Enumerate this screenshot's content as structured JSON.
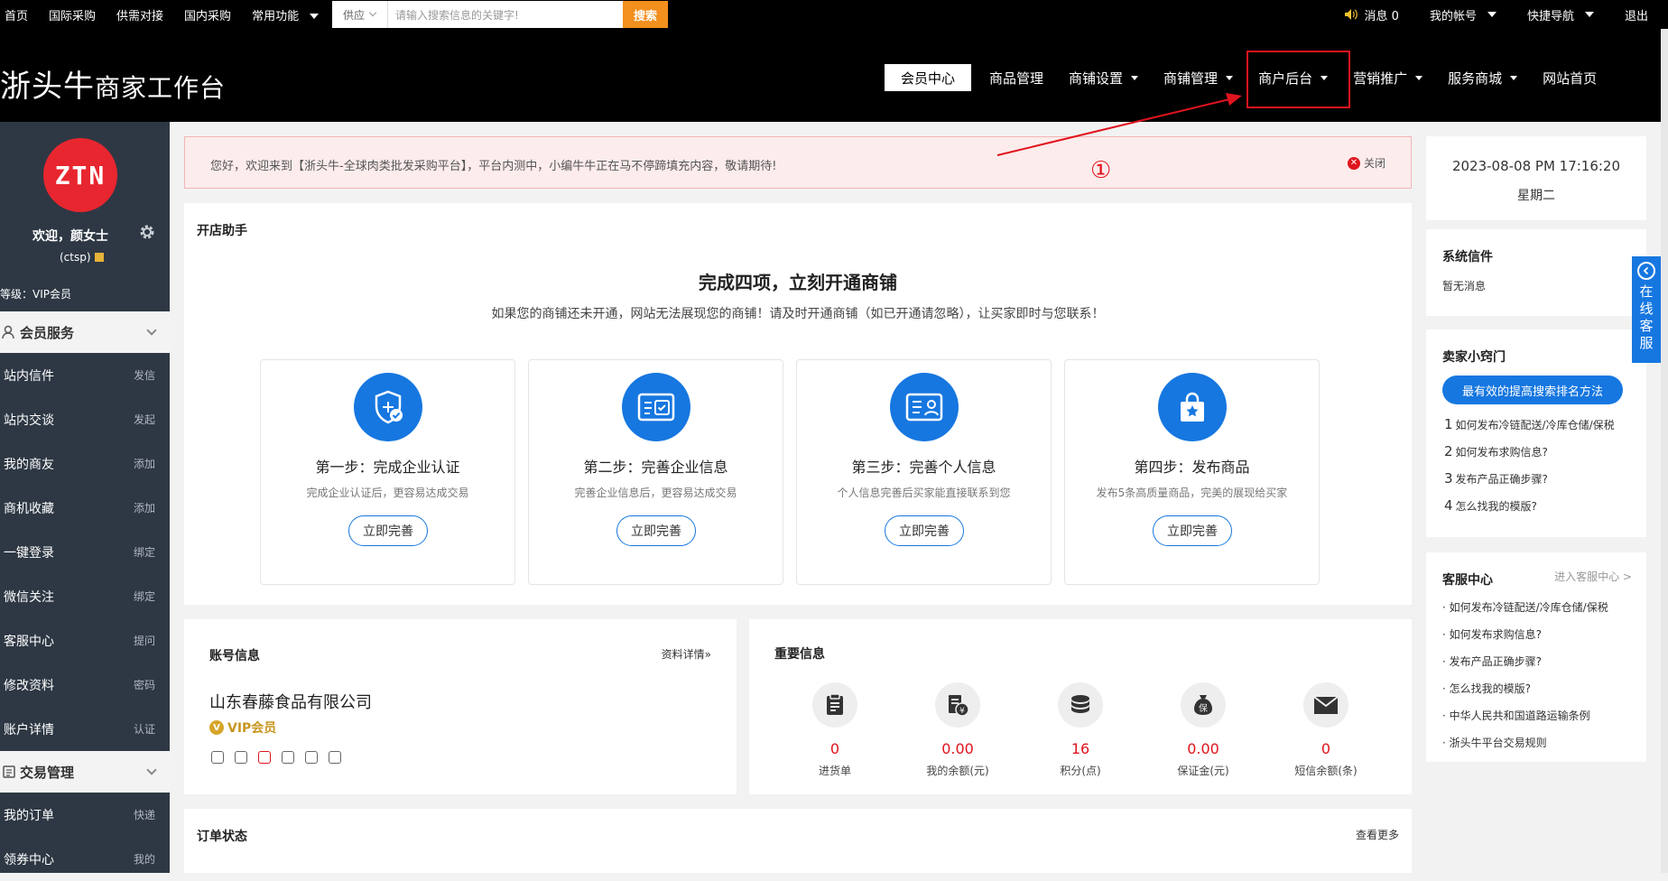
{
  "topbar": {
    "links": [
      "首页",
      "国际采购",
      "供需对接",
      "国内采购"
    ],
    "common": "常用功能",
    "search": {
      "category": "供应",
      "placeholder": "请输入搜索信息的关键字!",
      "button": "搜索"
    },
    "messages": "消息 0",
    "account": "我的帐号",
    "quicknav": "快捷导航",
    "logout": "退出"
  },
  "header": {
    "logo_main": "浙头牛",
    "logo_sub": "商家工作台",
    "nav": [
      {
        "label": "会员中心",
        "active": true,
        "dropdown": false
      },
      {
        "label": "商品管理",
        "active": false,
        "dropdown": false
      },
      {
        "label": "商铺设置",
        "active": false,
        "dropdown": true
      },
      {
        "label": "商铺管理",
        "active": false,
        "dropdown": true
      },
      {
        "label": "商户后台",
        "active": false,
        "dropdown": true
      },
      {
        "label": "营销推广",
        "active": false,
        "dropdown": true
      },
      {
        "label": "服务商城",
        "active": false,
        "dropdown": true
      },
      {
        "label": "网站首页",
        "active": false,
        "dropdown": false
      }
    ]
  },
  "annotation": {
    "marker": "①",
    "color": "#e0141d"
  },
  "sidebar": {
    "avatar": "ZTN",
    "welcome": "欢迎，颜女士",
    "username": "(ctsp)",
    "level": "等级：VIP会员",
    "sections": [
      {
        "title": "会员服务",
        "items": [
          {
            "label": "站内信件",
            "action": "发信"
          },
          {
            "label": "站内交谈",
            "action": "发起"
          },
          {
            "label": "我的商友",
            "action": "添加"
          },
          {
            "label": "商机收藏",
            "action": "添加"
          },
          {
            "label": "一键登录",
            "action": "绑定"
          },
          {
            "label": "微信关注",
            "action": "绑定"
          },
          {
            "label": "客服中心",
            "action": "提问"
          },
          {
            "label": "修改资料",
            "action": "密码"
          },
          {
            "label": "账户详情",
            "action": "认证"
          }
        ]
      },
      {
        "title": "交易管理",
        "items": [
          {
            "label": "我的订单",
            "action": "快递"
          },
          {
            "label": "领券中心",
            "action": "我的"
          }
        ]
      }
    ]
  },
  "notice": {
    "text": "您好，欢迎来到【浙头牛-全球肉类批发采购平台】，平台内测中，小编牛牛正在马不停蹄填充内容，敬请期待!",
    "close": "关闭"
  },
  "open_shop": {
    "title": "开店助手",
    "heading": "完成四项，立刻开通商铺",
    "subheading": "如果您的商铺还未开通，网站无法展现您的商铺！请及时开通商铺（如已开通请忽略），让买家即时与您联系！",
    "steps": [
      {
        "icon": "shield-certify-icon",
        "title": "第一步：完成企业认证",
        "desc": "完成企业认证后，更容易达成交易",
        "button": "立即完善"
      },
      {
        "icon": "license-card-icon",
        "title": "第二步：完善企业信息",
        "desc": "完善企业信息后，更容易达成交易",
        "button": "立即完善"
      },
      {
        "icon": "id-card-icon",
        "title": "第三步：完善个人信息",
        "desc": "个人信息完善后买家能直接联系到您",
        "button": "立即完善"
      },
      {
        "icon": "shopping-bag-icon",
        "title": "第四步：发布商品",
        "desc": "发布5条高质量商品，完美的展现给买家",
        "button": "立即完善"
      }
    ]
  },
  "account": {
    "title": "账号信息",
    "more": "资料详情»",
    "company": "山东春藤食品有限公司",
    "vip": "VIP会员",
    "vip_badge": "V"
  },
  "important": {
    "title": "重要信息",
    "items": [
      {
        "icon": "purchase-list-icon",
        "value": "0",
        "label": "进货单"
      },
      {
        "icon": "balance-icon",
        "value": "0.00",
        "label": "我的余额(元)"
      },
      {
        "icon": "points-coins-icon",
        "value": "16",
        "label": "积分(点)"
      },
      {
        "icon": "deposit-icon",
        "value": "0.00",
        "label": "保证金(元)"
      },
      {
        "icon": "sms-envelope-icon",
        "value": "0",
        "label": "短信余额(条)"
      }
    ]
  },
  "order": {
    "title": "订单状态",
    "more": "查看更多"
  },
  "right": {
    "datetime": "2023-08-08 PM 17:16:20",
    "weekday": "星期二",
    "mail_title": "系统信件",
    "mail_empty": "暂无消息",
    "tips_title": "卖家小窍门",
    "tips_button": "最有效的提高搜索排名方法",
    "tips": [
      {
        "n": "1",
        "text": "如何发布冷链配送/冷库仓储/保税"
      },
      {
        "n": "2",
        "text": "如何发布求购信息?"
      },
      {
        "n": "3",
        "text": "发布产品正确步骤?"
      },
      {
        "n": "4",
        "text": "怎么找我的模版?"
      }
    ],
    "service_title": "客服中心",
    "service_more": "进入客服中心 >",
    "service_links": [
      "· 如何发布冷链配送/冷库仓储/保税",
      "· 如何发布求购信息?",
      "· 发布产品正确步骤?",
      "· 怎么找我的模版?",
      "· 中华人民共和国道路运输条例",
      "· 浙头牛平台交易规则"
    ],
    "online_service": "在线客服",
    "online_chars": [
      "在",
      "线",
      "客",
      "服"
    ]
  },
  "colors": {
    "brand_blue": "#1677e0",
    "alert_red": "#e0141d",
    "search_orange": "#f28f1d",
    "avatar_red": "#e8262f"
  }
}
